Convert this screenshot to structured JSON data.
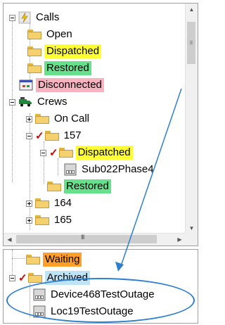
{
  "tree_top": {
    "calls_label": "Calls",
    "open_label": "Open",
    "dispatched_label": "Dispatched",
    "restored_label": "Restored",
    "disconnected_label": "Disconnected",
    "crews_label": "Crews",
    "on_call_label": "On Call",
    "crew_157_label": "157",
    "crew_157_dispatched_label": "Dispatched",
    "crew_157_device_label": "Sub022Phase4",
    "crew_157_restored_label": "Restored",
    "crew_164_label": "164",
    "crew_165_label": "165",
    "scroll_arrow_h": "III"
  },
  "tree_bottom": {
    "waiting_label": "Waiting",
    "archived_label": "Archived",
    "device1_label": "Device468TestOutage",
    "device2_label": "Loc19TestOutage"
  },
  "colors": {
    "yellow_highlight": "#ffff33",
    "green_highlight": "#66e08a",
    "pink_highlight": "#f7b3c0",
    "orange_highlight": "#ff9f2a",
    "selection_blue": "#bde3f5",
    "annotation_blue": "#2e7fd0",
    "check_red": "#d40000"
  }
}
